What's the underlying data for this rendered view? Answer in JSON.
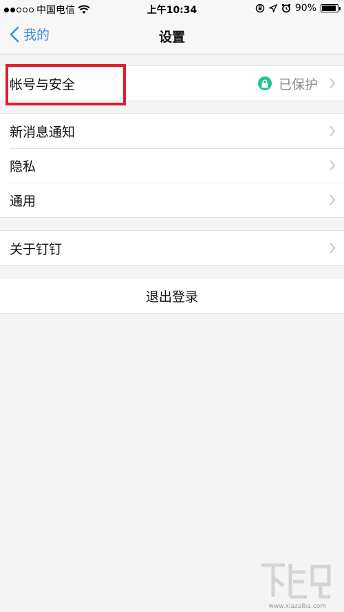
{
  "status_bar": {
    "carrier": "中国电信",
    "time": "上午10:34",
    "battery": "90%",
    "battery_level": 0.9
  },
  "nav": {
    "back_label": "我的",
    "title": "设置"
  },
  "account": {
    "label": "帐号与安全",
    "status": "已保护"
  },
  "settings_items": [
    {
      "label": "新消息通知"
    },
    {
      "label": "隐私"
    },
    {
      "label": "通用"
    }
  ],
  "about": {
    "label": "关于钉钉"
  },
  "logout_label": "退出登录",
  "watermark": {
    "url": "www.xiazaiba.com"
  },
  "colors": {
    "accent": "#3c8ee8",
    "lock_green": "#21c48f",
    "highlight_red": "#e01e2b"
  }
}
